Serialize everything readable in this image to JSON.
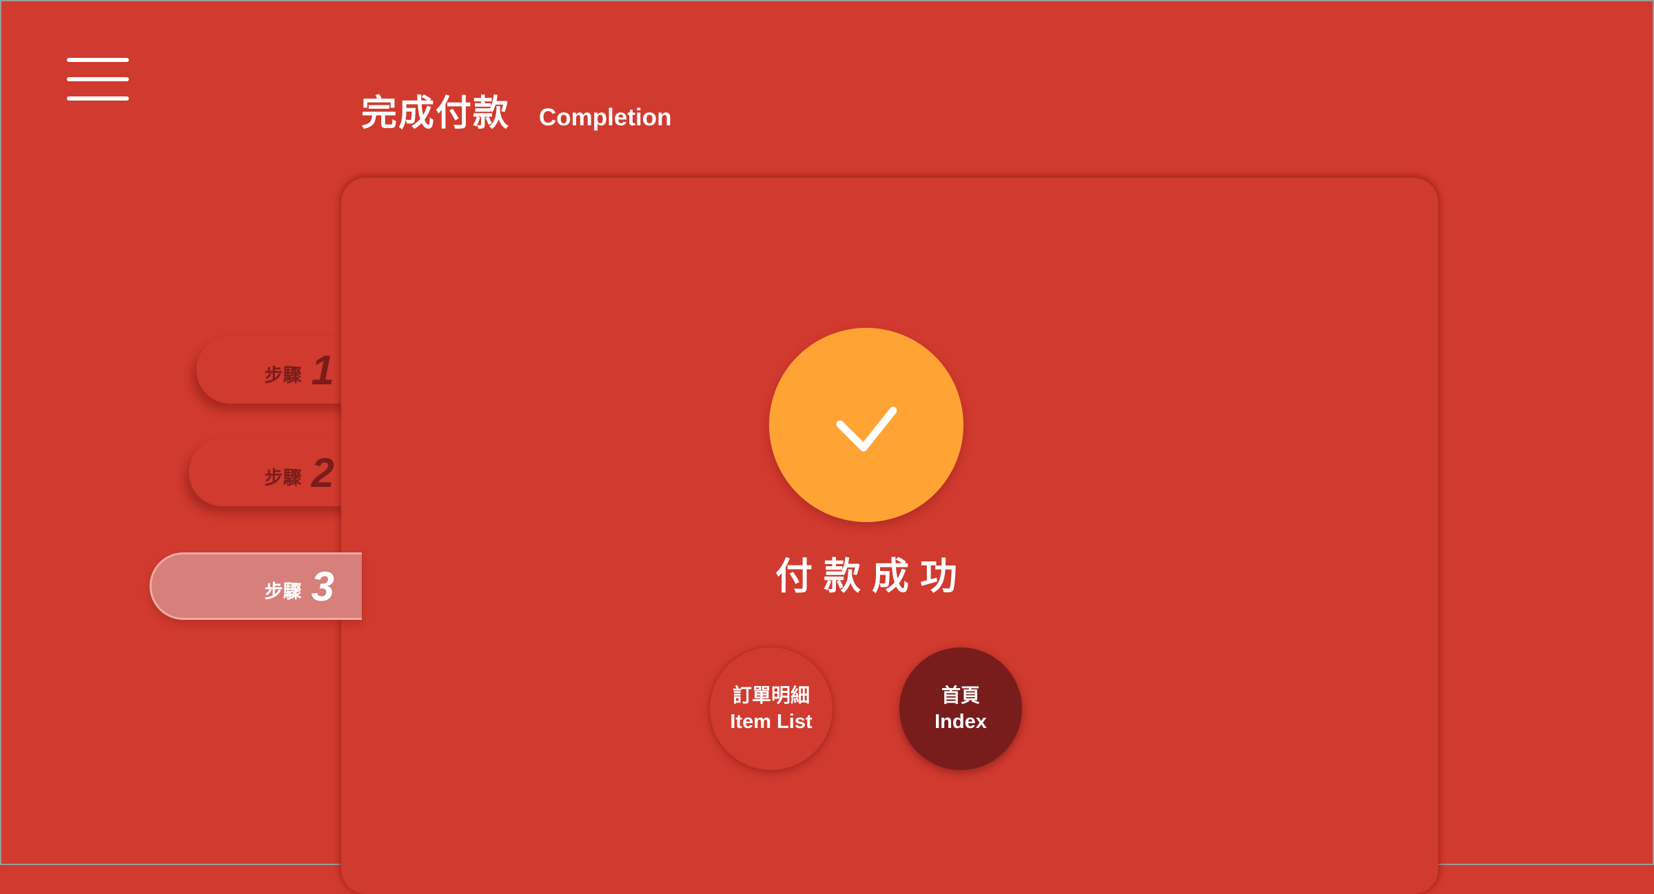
{
  "menu": {
    "icon": "hamburger-menu-icon"
  },
  "header": {
    "title_zh": "完成付款",
    "title_en": "Completion"
  },
  "steps": [
    {
      "label": "步驟",
      "number": "1",
      "active": false
    },
    {
      "label": "步驟",
      "number": "2",
      "active": false
    },
    {
      "label": "步驟",
      "number": "3",
      "active": true
    }
  ],
  "result": {
    "icon": "checkmark-icon",
    "message": "付款成功"
  },
  "actions": {
    "item_list": {
      "zh": "訂單明細",
      "en": "Item List"
    },
    "index": {
      "zh": "首頁",
      "en": "Index"
    }
  },
  "colors": {
    "background": "#d13a2f",
    "success_circle": "#ffa334",
    "step_text": "#7a1d19",
    "active_step": "#d67f7b",
    "index_button": "#781c1c"
  }
}
